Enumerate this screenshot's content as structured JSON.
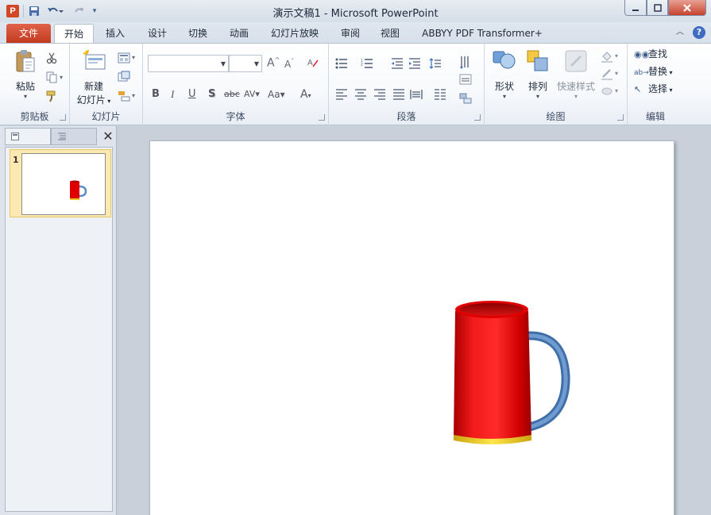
{
  "window": {
    "title": "演示文稿1  -  Microsoft PowerPoint",
    "app_icon": "P"
  },
  "quick_access": {
    "icons": [
      "save-icon",
      "undo-icon",
      "redo-icon",
      "customize-icon"
    ]
  },
  "tabs": [
    {
      "label": "文件"
    },
    {
      "label": "开始"
    },
    {
      "label": "插入"
    },
    {
      "label": "设计"
    },
    {
      "label": "切换"
    },
    {
      "label": "动画"
    },
    {
      "label": "幻灯片放映"
    },
    {
      "label": "审阅"
    },
    {
      "label": "视图"
    },
    {
      "label": "ABBYY PDF Transformer+"
    }
  ],
  "ribbon": {
    "clipboard": {
      "label": "剪贴板",
      "paste": "粘贴"
    },
    "slides": {
      "label": "幻灯片",
      "new_slide_line1": "新建",
      "new_slide_line2": "幻灯片"
    },
    "font": {
      "label": "字体",
      "font_name": "",
      "font_size": ""
    },
    "paragraph": {
      "label": "段落"
    },
    "drawing": {
      "label": "绘图",
      "shapes": "形状",
      "arrange": "排列",
      "quick_styles": "快速样式"
    },
    "editing": {
      "label": "编辑",
      "find": "查找",
      "replace": "替换",
      "select": "选择"
    }
  },
  "left_panel": {
    "slide_number": "1"
  },
  "colors": {
    "file_tab": "#c23a20",
    "mug_body": "#e00000",
    "mug_handle": "#5b8cc6",
    "mug_base": "#e8c619"
  }
}
